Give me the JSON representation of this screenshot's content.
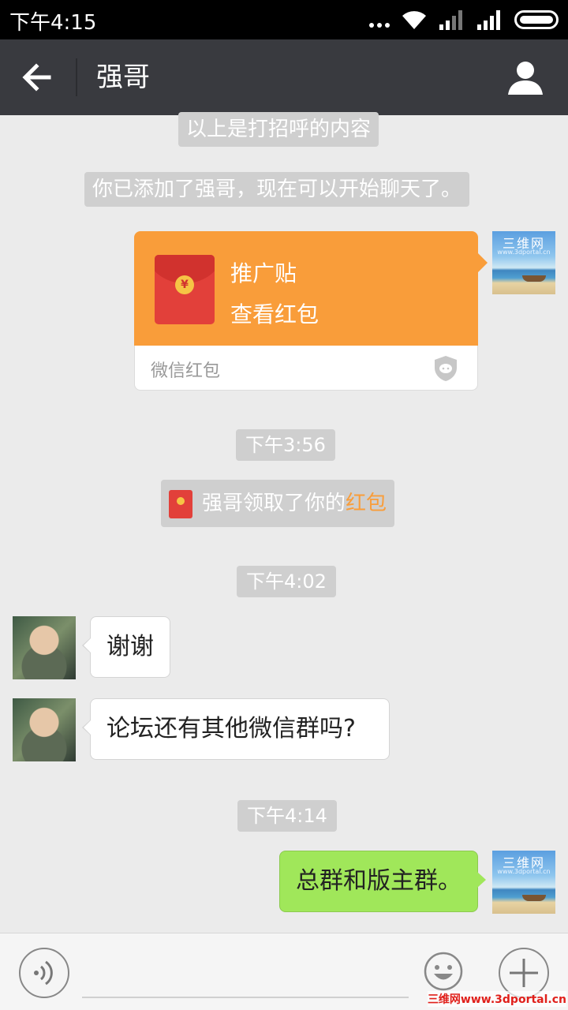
{
  "status_bar": {
    "time": "下午4:15"
  },
  "header": {
    "title": "强哥"
  },
  "messages": {
    "notice_greeting": "以上是打招呼的内容",
    "notice_added": "你已添加了强哥，现在可以开始聊天了。",
    "red_packet": {
      "title": "推广贴",
      "action": "查看红包",
      "brand": "微信红包"
    },
    "time_1": "下午3:56",
    "notice_received": {
      "prefix": "强哥领取了你的",
      "link": "红包"
    },
    "time_2": "下午4:02",
    "msg_thanks": "谢谢",
    "msg_question": "论坛还有其他微信群吗?",
    "time_3": "下午4:14",
    "msg_reply": "总群和版主群。"
  },
  "avatars": {
    "me": {
      "brand": "三维网",
      "site": "www.3dportal.cn"
    }
  },
  "input": {
    "placeholder": ""
  },
  "watermark": "三维网www.3dportal.cn",
  "colors": {
    "header_bg": "#393a3f",
    "red_packet": "#f99d3a",
    "outgoing_bubble": "#a0e75a",
    "chat_bg": "#ebebeb"
  }
}
